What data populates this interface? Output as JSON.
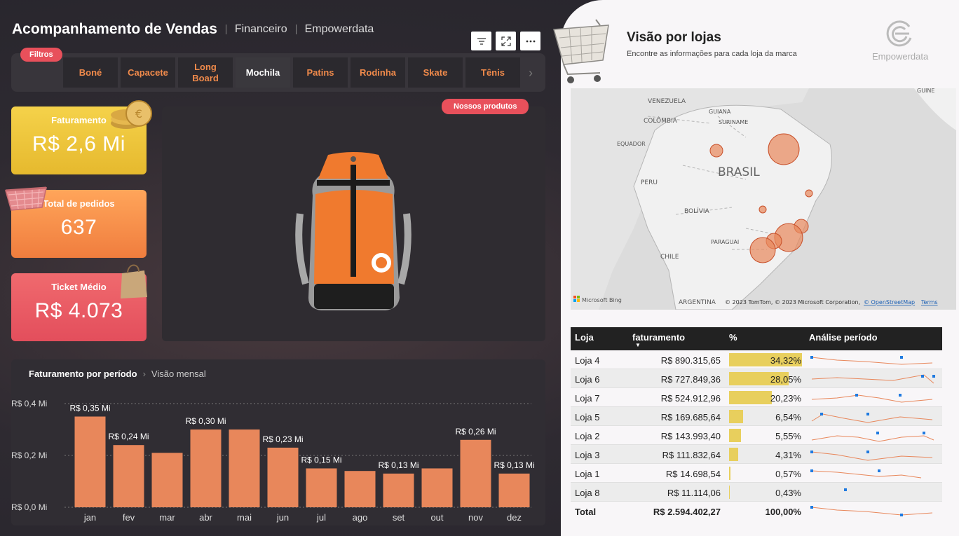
{
  "header": {
    "title": "Acompanhamento de Vendas",
    "crumb1": "Financeiro",
    "crumb2": "Empowerdata"
  },
  "toolbar": {
    "filter_icon": "filter-icon",
    "expand_icon": "expand-icon",
    "more_icon": "more-icon"
  },
  "filters": {
    "label": "Filtros",
    "tabs": [
      {
        "label": "Boné",
        "active": false
      },
      {
        "label": "Capacete",
        "active": false
      },
      {
        "label": "Long Board",
        "active": false
      },
      {
        "label": "Mochila",
        "active": true
      },
      {
        "label": "Patins",
        "active": false
      },
      {
        "label": "Rodinha",
        "active": false
      },
      {
        "label": "Skate",
        "active": false
      },
      {
        "label": "Tênis",
        "active": false
      }
    ]
  },
  "kpis": {
    "faturamento": {
      "label": "Faturamento",
      "value": "R$ 2,6 Mi"
    },
    "pedidos": {
      "label": "Total de pedidos",
      "value": "637"
    },
    "ticket": {
      "label": "Ticket Médio",
      "value": "R$ 4.073"
    }
  },
  "product": {
    "badge": "Nossos produtos"
  },
  "chart_title": {
    "main": "Faturamento por período",
    "sub": "Visão mensal"
  },
  "chart_data": {
    "type": "bar",
    "categories": [
      "jan",
      "fev",
      "mar",
      "abr",
      "mai",
      "jun",
      "jul",
      "ago",
      "set",
      "out",
      "nov",
      "dez"
    ],
    "values": [
      0.35,
      0.24,
      0.21,
      0.3,
      0.3,
      0.23,
      0.15,
      0.14,
      0.13,
      0.15,
      0.26,
      0.13
    ],
    "labels": [
      "R$ 0,35 Mi",
      "R$ 0,24 Mi",
      "",
      "R$ 0,30 Mi",
      "",
      "R$ 0,23 Mi",
      "R$ 0,15 Mi",
      "",
      "R$ 0,13 Mi",
      "",
      "R$ 0,26 Mi",
      "R$ 0,13 Mi"
    ],
    "yticks": [
      "R$ 0,0 Mi",
      "R$ 0,2 Mi",
      "R$ 0,4 Mi"
    ],
    "ylim": [
      0,
      0.4
    ],
    "title": "Faturamento por período",
    "color": "#e8875b"
  },
  "stores": {
    "title": "Visão por lojas",
    "subtitle": "Encontre as informações para cada loja da marca",
    "logo": "Empowerdata",
    "map": {
      "countries": [
        "VENEZUELA",
        "GUIANA",
        "SURINAME",
        "GUINE",
        "COLÔMBIA",
        "EQUADOR",
        "BRASIL",
        "PERU",
        "BOLÍVIA",
        "PARAGUAI",
        "CHILE",
        "ARGENTINA"
      ],
      "attribution": "© 2023 TomTom, © 2023 Microsoft Corporation,",
      "osm": "© OpenStreetMap",
      "terms": "Terms",
      "bing": "Microsoft Bing"
    },
    "table": {
      "headers": {
        "loja": "Loja",
        "faturamento": "faturamento",
        "pct": "%",
        "analise": "Análise período"
      },
      "rows": [
        {
          "loja": "Loja 4",
          "fat": "R$ 890.315,65",
          "pct": "34,32%",
          "p": 34.32
        },
        {
          "loja": "Loja 6",
          "fat": "R$ 727.849,36",
          "pct": "28,05%",
          "p": 28.05
        },
        {
          "loja": "Loja 7",
          "fat": "R$ 524.912,96",
          "pct": "20,23%",
          "p": 20.23
        },
        {
          "loja": "Loja 5",
          "fat": "R$ 169.685,64",
          "pct": "6,54%",
          "p": 6.54
        },
        {
          "loja": "Loja 2",
          "fat": "R$ 143.993,40",
          "pct": "5,55%",
          "p": 5.55
        },
        {
          "loja": "Loja 3",
          "fat": "R$ 111.832,64",
          "pct": "4,31%",
          "p": 4.31
        },
        {
          "loja": "Loja 1",
          "fat": "R$ 14.698,54",
          "pct": "0,57%",
          "p": 0.57
        },
        {
          "loja": "Loja 8",
          "fat": "R$ 11.114,06",
          "pct": "0,43%",
          "p": 0.43
        }
      ],
      "total": {
        "loja": "Total",
        "fat": "R$ 2.594.402,27",
        "pct": "100,00%"
      }
    }
  },
  "colors": {
    "accent": "#f08a4b",
    "pill": "#e8505b",
    "bar": "#e8875b",
    "tableBar": "#e8cf5d"
  }
}
